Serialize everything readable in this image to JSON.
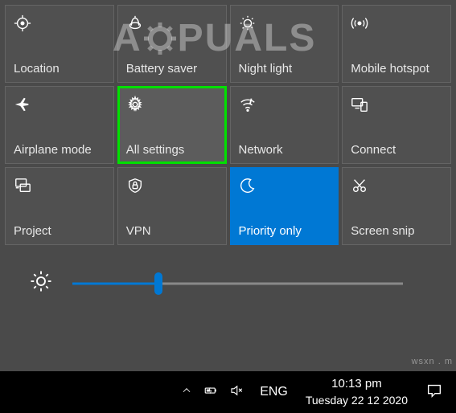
{
  "watermark": "A  PUALS",
  "tiles": [
    {
      "key": "location",
      "label": "Location",
      "active": false,
      "highlighted": false
    },
    {
      "key": "battery-saver",
      "label": "Battery saver",
      "active": false,
      "highlighted": false
    },
    {
      "key": "night-light",
      "label": "Night light",
      "active": false,
      "highlighted": false
    },
    {
      "key": "mobile-hotspot",
      "label": "Mobile hotspot",
      "active": false,
      "highlighted": false
    },
    {
      "key": "airplane-mode",
      "label": "Airplane mode",
      "active": false,
      "highlighted": false
    },
    {
      "key": "all-settings",
      "label": "All settings",
      "active": false,
      "highlighted": true
    },
    {
      "key": "network",
      "label": "Network",
      "active": false,
      "highlighted": false
    },
    {
      "key": "connect",
      "label": "Connect",
      "active": false,
      "highlighted": false
    },
    {
      "key": "project",
      "label": "Project",
      "active": false,
      "highlighted": false
    },
    {
      "key": "vpn",
      "label": "VPN",
      "active": false,
      "highlighted": false
    },
    {
      "key": "priority-only",
      "label": "Priority only",
      "active": true,
      "highlighted": false
    },
    {
      "key": "screen-snip",
      "label": "Screen snip",
      "active": false,
      "highlighted": false
    }
  ],
  "brightness": {
    "percent": 26
  },
  "taskbar": {
    "lang": "ENG",
    "time": "10:13 pm",
    "date": "Tuesday 22 12 2020"
  },
  "corner_mark": "wsxn . m"
}
